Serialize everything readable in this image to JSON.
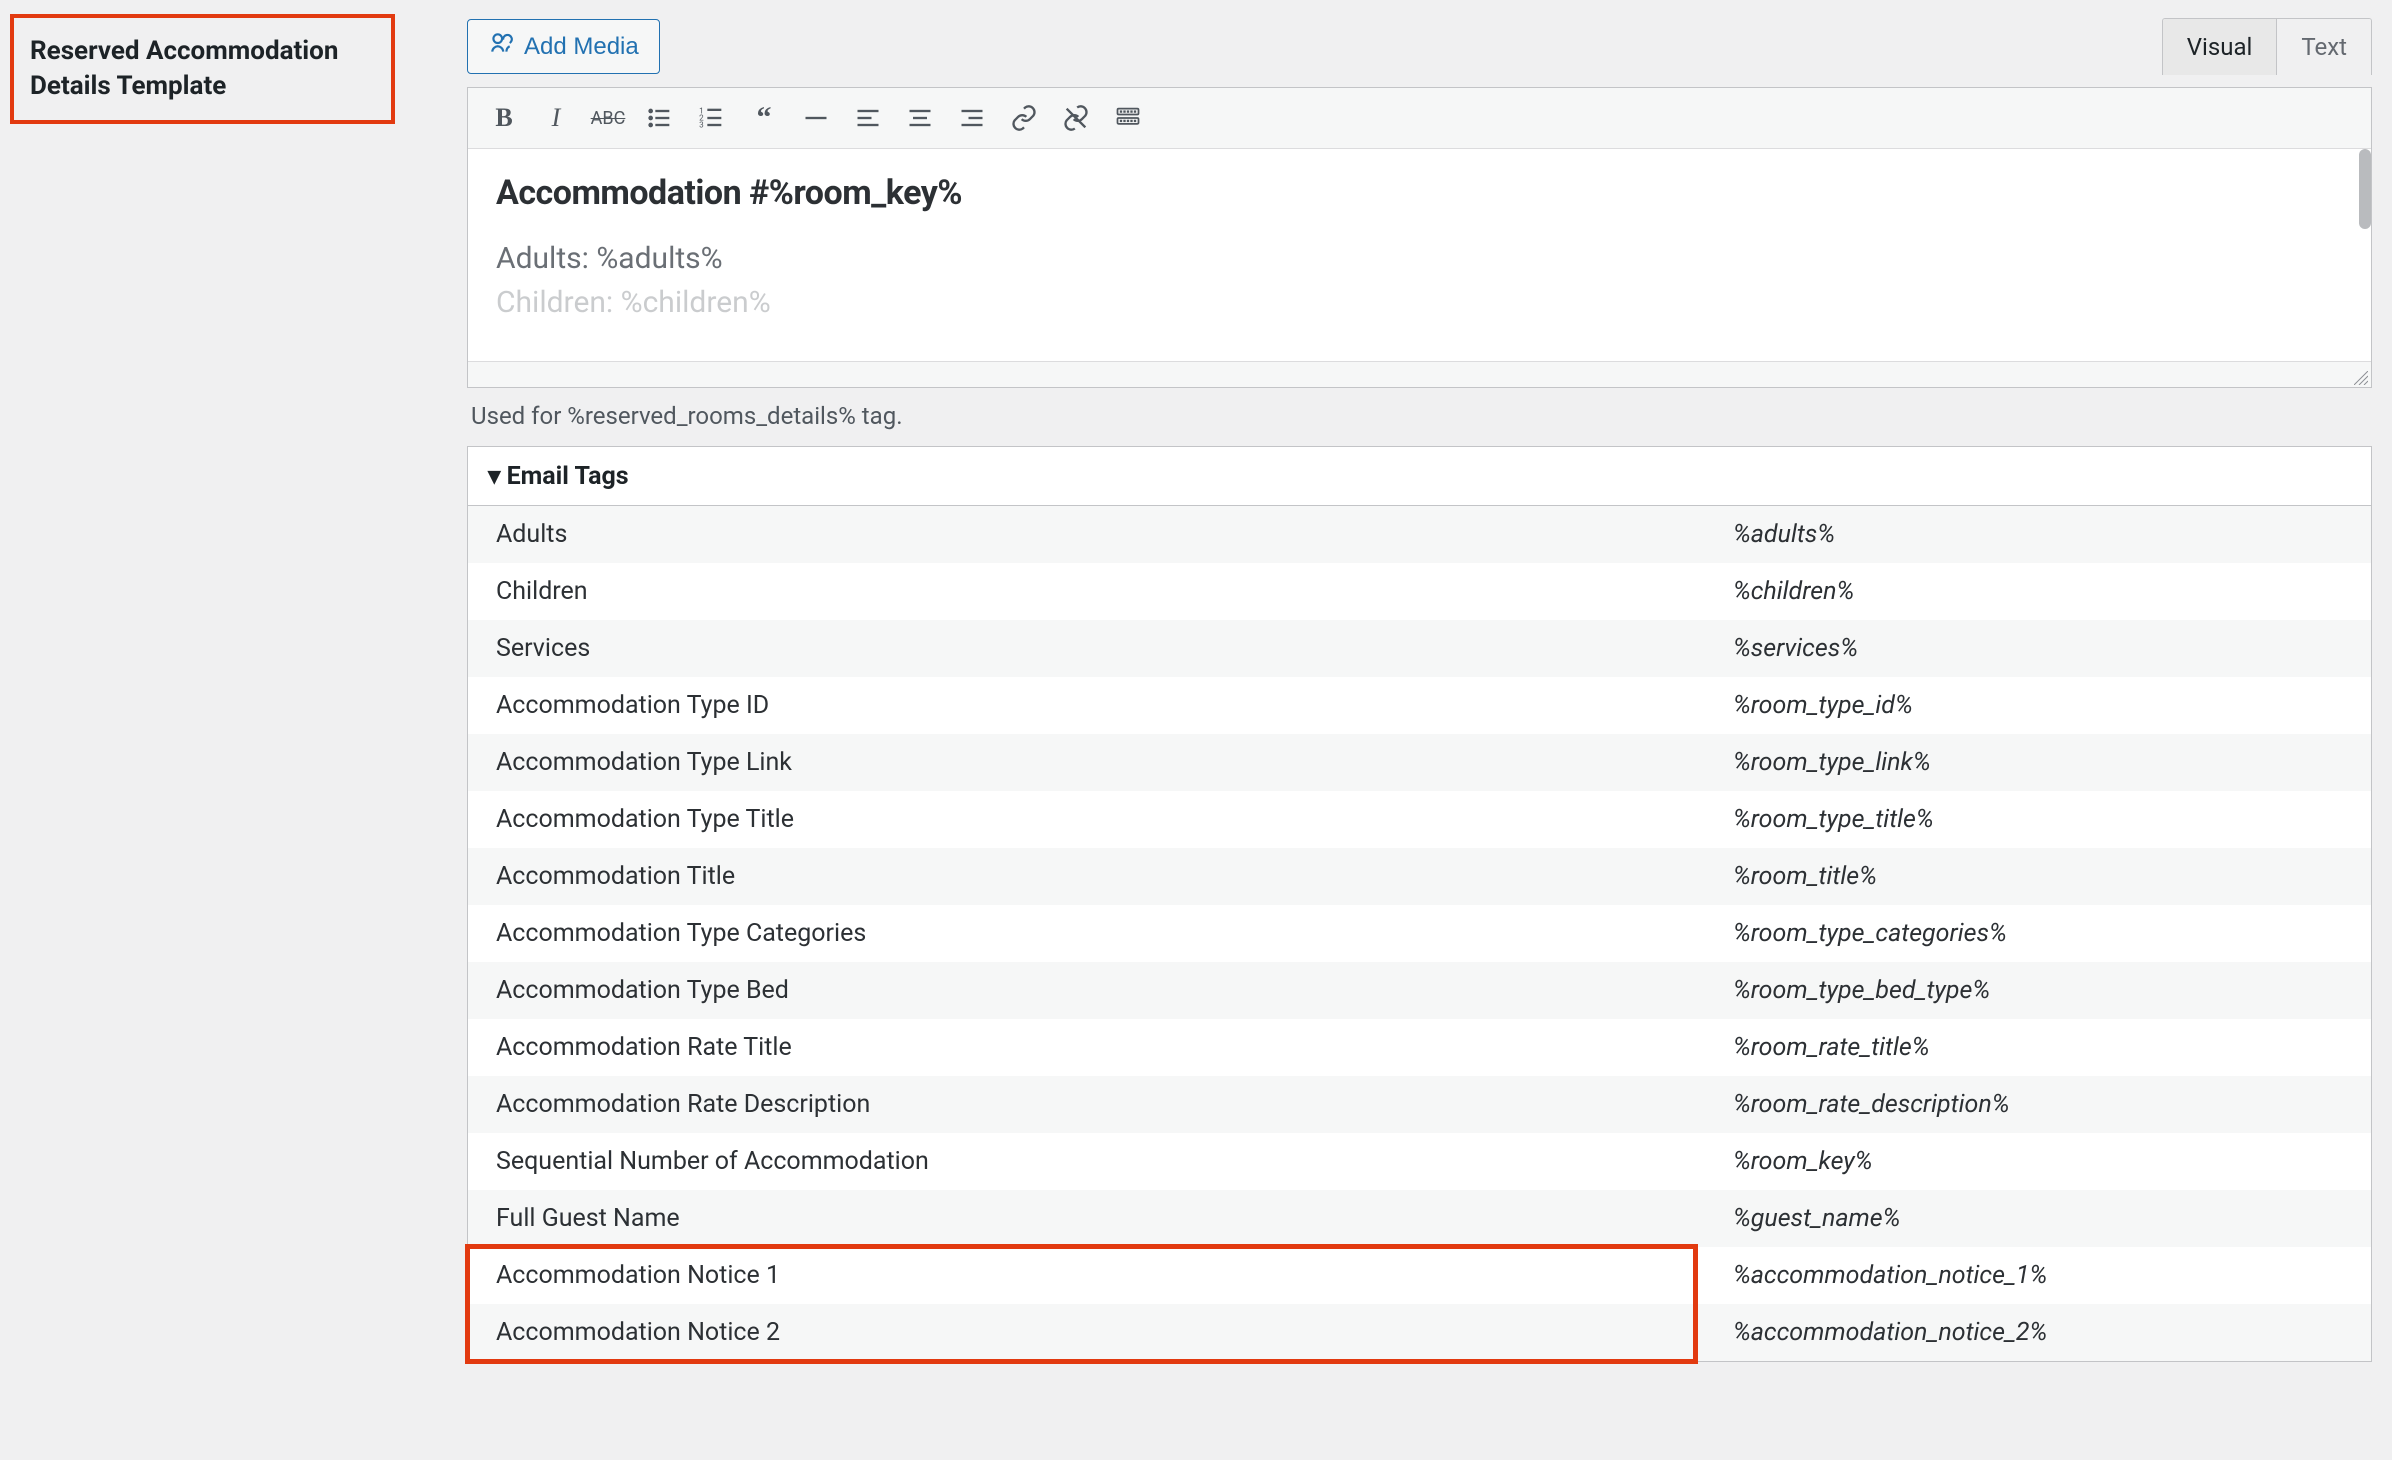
{
  "leftLabel": "Reserved Accommodation Details Template",
  "addMedia": "Add Media",
  "tabs": {
    "visual": "Visual",
    "text": "Text"
  },
  "editor": {
    "heading": "Accommodation #%room_key%",
    "line1": "Adults: %adults%",
    "line2": "Children: %children%"
  },
  "helper": "Used for %reserved_rooms_details% tag.",
  "emailTagsHeader": "Email Tags",
  "tags": [
    {
      "label": "Adults",
      "val": "%adults%"
    },
    {
      "label": "Children",
      "val": "%children%"
    },
    {
      "label": "Services",
      "val": "%services%"
    },
    {
      "label": "Accommodation Type ID",
      "val": "%room_type_id%"
    },
    {
      "label": "Accommodation Type Link",
      "val": "%room_type_link%"
    },
    {
      "label": "Accommodation Type Title",
      "val": "%room_type_title%"
    },
    {
      "label": "Accommodation Title",
      "val": "%room_title%"
    },
    {
      "label": "Accommodation Type Categories",
      "val": "%room_type_categories%"
    },
    {
      "label": "Accommodation Type Bed",
      "val": "%room_type_bed_type%"
    },
    {
      "label": "Accommodation Rate Title",
      "val": "%room_rate_title%"
    },
    {
      "label": "Accommodation Rate Description",
      "val": "%room_rate_description%"
    },
    {
      "label": "Sequential Number of Accommodation",
      "val": "%room_key%"
    },
    {
      "label": "Full Guest Name",
      "val": "%guest_name%"
    },
    {
      "label": "Accommodation Notice 1",
      "val": "%accommodation_notice_1%"
    },
    {
      "label": "Accommodation Notice 2",
      "val": "%accommodation_notice_2%"
    }
  ]
}
